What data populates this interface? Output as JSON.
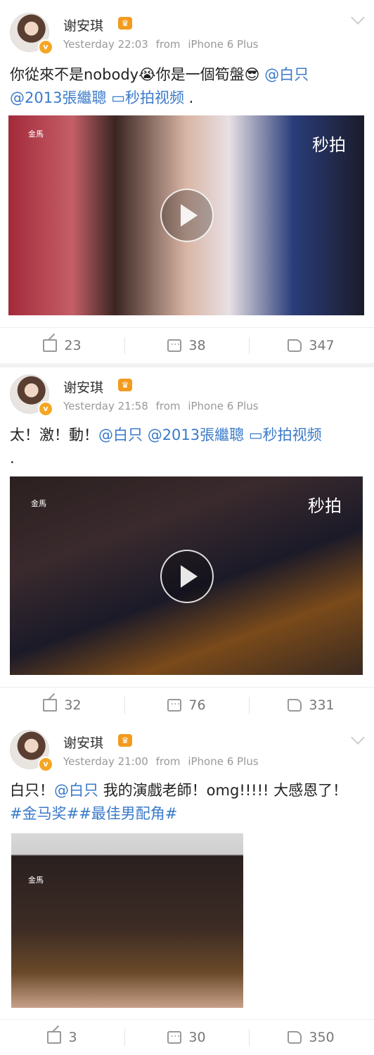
{
  "posts": [
    {
      "author": "谢安琪",
      "time": "Yesterday 22:03",
      "from_label": "from",
      "source": "iPhone 6 Plus",
      "text_a": "你從來不是nobody",
      "emoji1": "😭",
      "text_b": "你是一個筍盤",
      "emoji2": "😎",
      "mention1": "@白只",
      "mention2": "@2013張繼聰",
      "video_link": "秒拍视频",
      "end": ".",
      "watermark": "秒拍",
      "corner": "金馬",
      "shares": "23",
      "comments": "38",
      "likes": "347"
    },
    {
      "author": "谢安琪",
      "time": "Yesterday 21:58",
      "from_label": "from",
      "source": "iPhone 6 Plus",
      "text_a": "太！激！動！",
      "mention1": "@白只",
      "mention2": "@2013張繼聰",
      "video_link": "秒拍视频",
      "end": ".",
      "watermark": "秒拍",
      "corner": "金馬",
      "shares": "32",
      "comments": "76",
      "likes": "331"
    },
    {
      "author": "谢安琪",
      "time": "Yesterday 21:00",
      "from_label": "from",
      "source": "iPhone 6 Plus",
      "text_a": "白只！",
      "mention1": "@白只",
      "text_b": "我的演戲老師！omg!!!!! 大感恩了！",
      "hashtag1": "#金马奖#",
      "hashtag2": "#最佳男配角#",
      "corner": "金馬",
      "shares": "3",
      "comments": "30",
      "likes": "350"
    }
  ]
}
